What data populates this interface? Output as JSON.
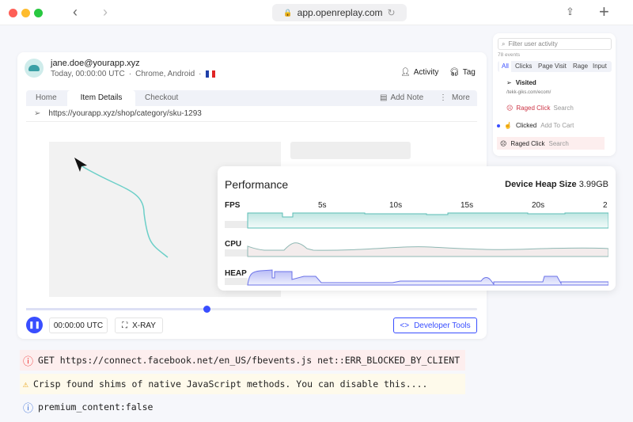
{
  "browser": {
    "url": "app.openreplay.com"
  },
  "session": {
    "user": "jane.doe@yourapp.xyz",
    "time": "Today, 00:00:00 UTC",
    "sep": "·",
    "env": "Chrome, Android",
    "activity_label": "Activity",
    "tag_label": "Tag"
  },
  "tabs": [
    {
      "label": "Home"
    },
    {
      "label": "Item Details",
      "active": true
    },
    {
      "label": "Checkout"
    }
  ],
  "toolbar": {
    "add_note": "Add Note",
    "more": "More"
  },
  "page_url": "https://yourapp.xyz/shop/category/sku-1293",
  "player": {
    "progress_percent": 40,
    "time": "00:00:00 UTC",
    "xray": "X-RAY",
    "devtools": "Developer Tools"
  },
  "events": {
    "search_placeholder": "Filter user activity",
    "count": "78 events",
    "filters": [
      "All",
      "Clicks",
      "Page Visit",
      "Rage",
      "Input"
    ],
    "items": [
      {
        "type": "Visited",
        "detail": "/tekk-giks.com/ecom/"
      },
      {
        "type": "Raged Click",
        "detail": "Search"
      },
      {
        "type": "Clicked",
        "detail": "Add To Cart"
      },
      {
        "type": "Raged Click",
        "detail": "Search"
      }
    ]
  },
  "performance": {
    "title": "Performance",
    "heap_label": "Device Heap Size",
    "heap_value": "3.99GB",
    "ticks": [
      "5s",
      "10s",
      "15s",
      "20s",
      "2"
    ],
    "rows": [
      "FPS",
      "CPU",
      "HEAP"
    ],
    "colors": {
      "fps": "#5bbdb6",
      "cpu": "#7fb4b0",
      "heap": "#6b73e8"
    }
  },
  "console": [
    {
      "level": "error",
      "text": "GET https://connect.facebook.net/en_US/fbevents.js net::ERR_BLOCKED_BY_CLIENT"
    },
    {
      "level": "warning",
      "text": "Crisp found shims of native JavaScript methods. You can disable this...."
    },
    {
      "level": "info",
      "text": "premium_content:false"
    }
  ],
  "accent": "#394eff"
}
